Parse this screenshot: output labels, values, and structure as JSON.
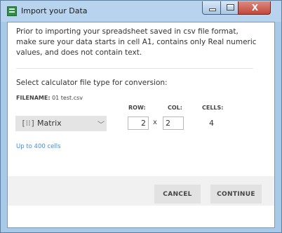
{
  "window": {
    "title": "Import your Data",
    "close_glyph": "X"
  },
  "instructions": "Prior to importing your spreadsheet saved in csv file format, make sure your data starts in cell A1, contains only Real numeric values, and does not contain text.",
  "select_label": "Select calculator file type for conversion:",
  "file": {
    "label": "FILENAME:",
    "name": "01 test.csv"
  },
  "grid": {
    "row_label": "ROW:",
    "col_label": "COL:",
    "cells_label": "CELLS:",
    "rows": "2",
    "cols": "2",
    "times": "x",
    "cells": "4"
  },
  "file_type": {
    "icon": "matrix-icon",
    "selected": "Matrix"
  },
  "limit_text": "Up to 400 cells",
  "buttons": {
    "cancel": "CANCEL",
    "continue": "CONTINUE"
  },
  "colors": {
    "link": "#3f8ee0",
    "title_bar": "#b7d3ee",
    "close_button": "#c2463b"
  }
}
